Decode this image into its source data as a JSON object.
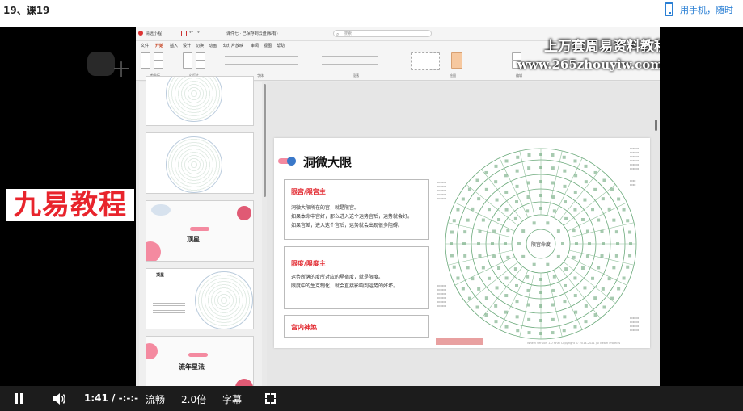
{
  "page": {
    "title": "19、课19",
    "phone_link": "用手机，随时"
  },
  "left_overlay": {
    "logo_text": "十",
    "jiuyi_logo": "九易教程"
  },
  "ppt": {
    "app_name": "清远小程",
    "doc_title": "课件七 · 已保存到云盘(私有)",
    "search_placeholder": "搜索",
    "menu": [
      "文件",
      "开始",
      "插入",
      "设计",
      "切换",
      "动画",
      "幻灯片放映",
      "审阅",
      "视图",
      "帮助"
    ],
    "ribbon_groups": [
      "剪贴板",
      "幻灯片",
      "字体",
      "段落",
      "绘图",
      "编辑"
    ],
    "watermark_line1": "上万套周易资料教程",
    "watermark_line2": "www.265zhouyiw.com",
    "thumbnails": [
      {
        "num": "3"
      },
      {
        "num": "4"
      },
      {
        "num": "5",
        "title": "顶星"
      },
      {
        "num": "6",
        "title": "顶星"
      },
      {
        "num": "7",
        "title": "流年星法"
      }
    ],
    "slide": {
      "title": "洞微大限",
      "box1": {
        "heading": "限宫/限宫主",
        "lines": [
          "洞微大限所在的宫，就是限宫。",
          "如果本命中宫好，那么进入这个运势宫后，运势就会好。",
          "如果宫差，进入这个宫后，运势就会出现很多阻碍。"
        ]
      },
      "box2": {
        "heading": "限度/限度主",
        "lines": [
          "运势所落的度所对应的星宿度，就是限度。",
          "限度中的生克制化，就会直接影响到运势的好坏。"
        ]
      },
      "box3": {
        "heading": "宫内神煞"
      },
      "chart_center": "限宫命度",
      "footer": "Wheel version 1.0 Final   Copyright © 2014-2021 Jui Beam Projects"
    }
  },
  "controls": {
    "time": "1:41 / -:-:-",
    "quality": "流畅",
    "speed": "2.0倍",
    "subtitle": "字幕"
  }
}
